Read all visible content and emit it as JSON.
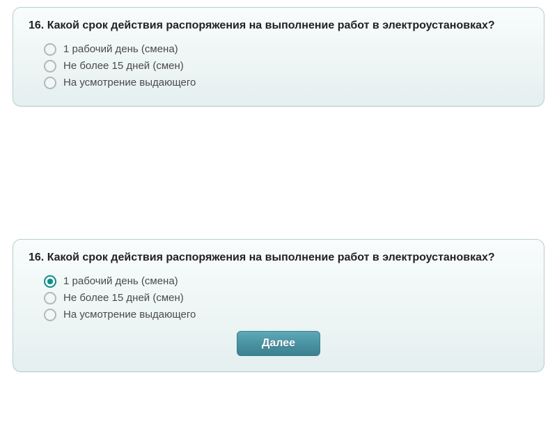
{
  "card1": {
    "question": "16. Какой срок действия распоряжения на выполнение работ в электроустановках?",
    "options": [
      {
        "label": "1 рабочий день (смена)",
        "selected": false
      },
      {
        "label": "Не более 15 дней (смен)",
        "selected": false
      },
      {
        "label": "На усмотрение выдающего",
        "selected": false
      }
    ]
  },
  "card2": {
    "question": "16. Какой срок действия распоряжения на выполнение работ в электроустановках?",
    "options": [
      {
        "label": "1 рабочий день (смена)",
        "selected": true
      },
      {
        "label": "Не более 15 дней (смен)",
        "selected": false
      },
      {
        "label": "На усмотрение выдающего",
        "selected": false
      }
    ],
    "next_label": "Далее"
  }
}
